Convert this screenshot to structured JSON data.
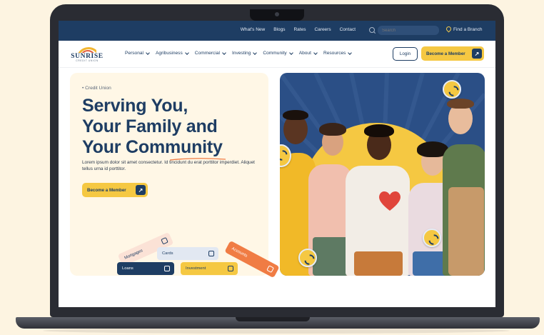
{
  "topbar": {
    "links": [
      "What's New",
      "Blogs",
      "Rates",
      "Careers",
      "Contact"
    ],
    "search_placeholder": "Search",
    "branch_link": "Find a Branch"
  },
  "logo": {
    "name": "SUNRISE",
    "tagline": "CREDIT UNION"
  },
  "nav": {
    "items": [
      "Personal",
      "Agribusiness",
      "Commercial",
      "Investing",
      "Community",
      "About",
      "Resources"
    ],
    "login_label": "Login",
    "member_label": "Become a Member"
  },
  "hero": {
    "eyebrow": "• Credit Union",
    "headline": [
      "Serving You,",
      "Your Family and",
      "Your Community"
    ],
    "body": "Lorem ipsum dolor sit amet consectetur. Id tincidunt du erat porttitor imperdiet. Aliquet tellus urna id porttitor.",
    "cta_label": "Become a Member"
  },
  "tags": {
    "mortgages": "Mortgages",
    "cards": "Cards",
    "accounts": "Accounts",
    "loans": "Loans",
    "investment": "Investment"
  },
  "colors": {
    "navy": "#1e3d63",
    "yellow": "#f5c842",
    "orange": "#f07c44",
    "cream": "#fff7e6",
    "page_bg": "#fdf4e1"
  },
  "icons": [
    "search-icon",
    "map-pin-icon",
    "chevron-down-icon",
    "arrow-up-right-icon",
    "heart-icon",
    "coin-icon"
  ]
}
